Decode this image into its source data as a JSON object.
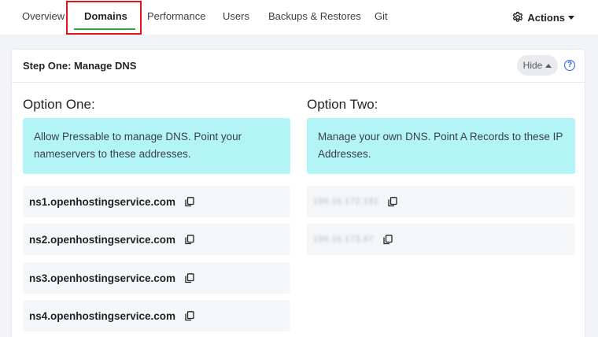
{
  "tabs": [
    {
      "label": "Overview"
    },
    {
      "label": "Domains"
    },
    {
      "label": "Performance"
    },
    {
      "label": "Users"
    },
    {
      "label": "Backups & Restores"
    },
    {
      "label": "Git"
    }
  ],
  "active_tab": "Domains",
  "actions": {
    "label": "Actions",
    "icon": "gear-icon"
  },
  "card": {
    "title": "Step One: Manage DNS",
    "hide_label": "Hide",
    "help_icon": "?"
  },
  "option_one": {
    "heading": "Option One:",
    "description": "Allow Pressable to manage DNS. Point your nameservers to these addresses.",
    "nameservers": [
      "ns1.openhostingservice.com",
      "ns2.openhostingservice.com",
      "ns3.openhostingservice.com",
      "ns4.openhostingservice.com"
    ]
  },
  "option_two": {
    "heading": "Option Two:",
    "description": "Manage your own DNS. Point A Records to these IP Addresses.",
    "ip_addresses": [
      "199.16.172.181",
      "199.16.173.87"
    ]
  },
  "colors": {
    "accent_underline": "#2da44e",
    "highlight_box": "#e3161b",
    "info_box": "#b3f5f7",
    "link": "#2b5ce6"
  }
}
